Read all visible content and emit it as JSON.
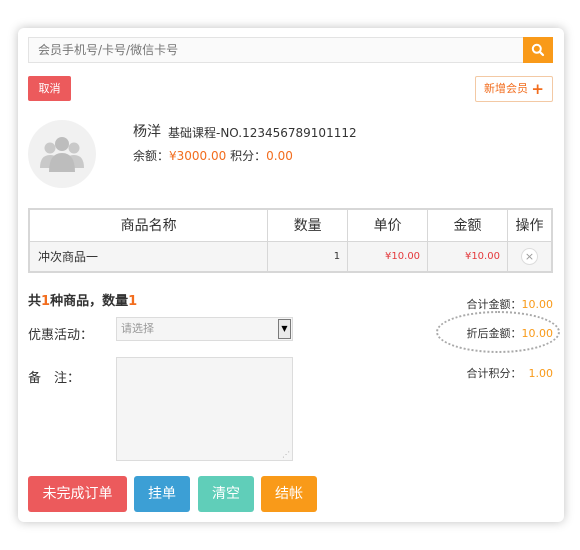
{
  "search": {
    "placeholder": "会员手机号/卡号/微信卡号"
  },
  "buttons": {
    "cancel": "取消",
    "add_member": "新增会员",
    "add_member_icon": "plus-icon"
  },
  "member": {
    "name": "杨洋",
    "course": "基础课程-NO.123456789101112",
    "balance_label": "余额：",
    "balance_value": "¥3000.00",
    "points_label": "积分：",
    "points_value": "0.00"
  },
  "table": {
    "headers": {
      "name": "商品名称",
      "qty": "数量",
      "price": "单价",
      "amount": "金额",
      "op": "操作"
    },
    "rows": [
      {
        "name": "冲次商品一",
        "qty": "1",
        "price": "¥10.00",
        "amount": "¥10.00",
        "remove": "×"
      }
    ]
  },
  "summary": {
    "prefix": "共",
    "kinds": "1",
    "mid": "种商品，数量",
    "qty": "1"
  },
  "form": {
    "promo_label": "优惠活动：",
    "promo_placeholder": "请选择",
    "remark_label": "备　注："
  },
  "totals": {
    "total_label": "合计金额：",
    "total_value": "10.00",
    "discount_label": "折后金额：",
    "discount_value": "10.00",
    "points_label": "合计积分：",
    "points_value": "1.00"
  },
  "actions": {
    "unfinished": "未完成订单",
    "hold": "挂单",
    "clear": "清空",
    "checkout": "结帐"
  },
  "colors": {
    "orange": "#f99a19",
    "red": "#ec5a5c",
    "blue": "#3c9fd5",
    "teal": "#60ceb9"
  }
}
